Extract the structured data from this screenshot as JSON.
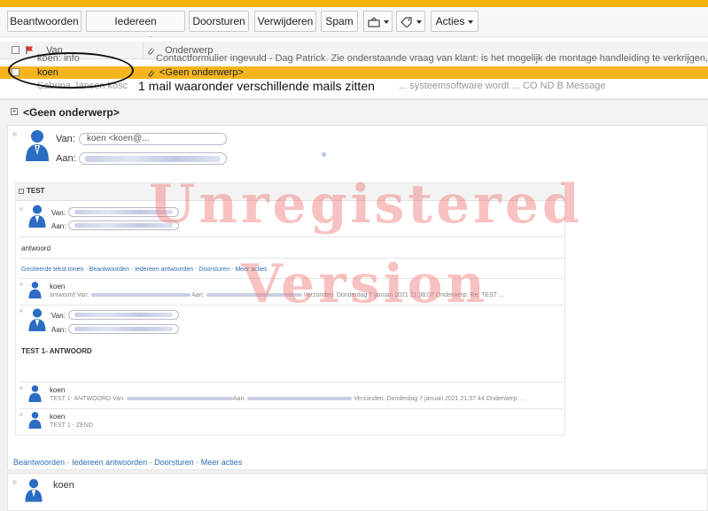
{
  "toolbar": {
    "reply": "Beantwoorden",
    "reply_all": "Iedereen antwoorden",
    "forward": "Doorsturen",
    "delete": "Verwijderen",
    "spam": "Spam",
    "actions": "Acties"
  },
  "list": {
    "header_from": "Van",
    "header_subject": "Onderwerp",
    "rows": [
      {
        "from": "koen: info",
        "subject": "Contactformulier ingevuld - Dag Patrick. Zie onderstaande vraag van klant: is het mogelijk de montage handleiding te verkrijgen, kwestie"
      },
      {
        "from": "koen",
        "subject": "<Geen onderwerp>"
      },
      {
        "from": "Sabrina Jansen kosc",
        "subject": "... systeemsoftware wordt ... CO ND B Message"
      }
    ]
  },
  "annotation": "1 mail waaronder verschillende mails zitten",
  "preview": {
    "title": "<Geen onderwerp>",
    "van_label": "Van:",
    "aan_label": "Aan:",
    "van_value": "koen <koen@..."
  },
  "thread": {
    "title": "TEST",
    "van_label": "Van:",
    "aan_label": "Aan:",
    "body": "antwoord",
    "actions": [
      "Geciteerde tekst tonen",
      "Beantwoorden",
      "Iedereen antwoorden",
      "Doorsturen",
      "Meer acties"
    ],
    "items": [
      {
        "name": "koen",
        "snippet": "antwoord Van:",
        "snippet_tail": "Aan:",
        "meta": "Verzonden: Donderdag 7 januari 2021 21:38:07 Onderwerp: Re: TEST ..."
      },
      {
        "name": "koen",
        "snippet": "TEST 1- ANTWOORD Van:",
        "snippet_tail": "Aan:",
        "meta": "Verzonden: Donderdag 7 januari 2021 21:37:44 Onderwerp: ..."
      },
      {
        "name": "koen",
        "snippet": "TEST 1 - ZEND",
        "snippet_tail": "",
        "meta": ""
      }
    ],
    "expanded_body": "TEST 1- ANTWOORD"
  },
  "bottom_actions": [
    "Beantwoorden",
    "Iedereen antwoorden",
    "Doorsturen",
    "Meer acties"
  ],
  "last_sender": "koen",
  "watermark": {
    "line1": "Unregistered",
    "line2": "Version"
  },
  "colors": {
    "accent": "#f5b51f",
    "link": "#2f6fb3",
    "avatar": "#2b6cc4"
  }
}
